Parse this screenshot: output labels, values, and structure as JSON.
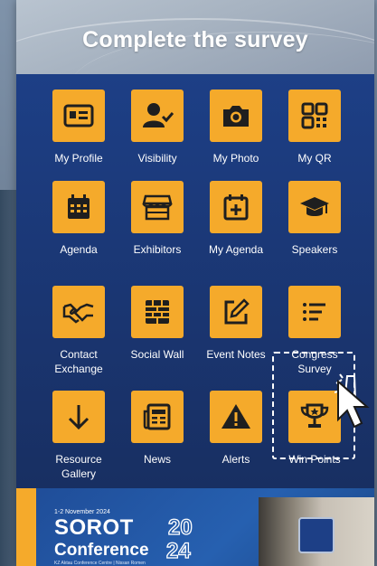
{
  "header": {
    "title": "Complete the survey"
  },
  "tiles": [
    {
      "label": "My Profile"
    },
    {
      "label": "Visibility"
    },
    {
      "label": "My Photo"
    },
    {
      "label": "My QR"
    },
    {
      "label": "Agenda"
    },
    {
      "label": "Exhibitors"
    },
    {
      "label": "My Agenda"
    },
    {
      "label": "Speakers"
    },
    {
      "label": "Contact Exchange"
    },
    {
      "label": "Social Wall"
    },
    {
      "label": "Event Notes"
    },
    {
      "label": "Congress Survey"
    },
    {
      "label": "Resource Gallery"
    },
    {
      "label": "News"
    },
    {
      "label": "Alerts"
    },
    {
      "label": "Win Points"
    }
  ],
  "banner": {
    "date": "1-2 November 2024",
    "name_line1": "SOROT",
    "year_part1": "20",
    "name_line2": "Conference",
    "year_part2": "24",
    "venue": "KZ Aktau Conference Centre | Nissan Romen"
  },
  "colors": {
    "tile": "#f5aa2b",
    "grid_bg": "#1d3f86",
    "header_bg": "#aab5c3"
  }
}
